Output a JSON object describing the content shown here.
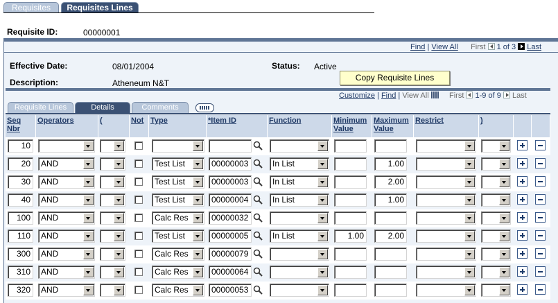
{
  "page_tabs": [
    {
      "label": "Requisites",
      "active": false
    },
    {
      "label": "Requisites Lines",
      "active": true
    }
  ],
  "requisite": {
    "id_label": "Requisite ID:",
    "id_value": "00000001"
  },
  "outer_nav": {
    "find": "Find",
    "view_all": "View All",
    "first": "First",
    "range": "1 of 3",
    "last": "Last"
  },
  "effdt": {
    "label": "Effective Date:",
    "value": "08/01/2004"
  },
  "status": {
    "label": "Status:",
    "value": "Active"
  },
  "description": {
    "label": "Description:",
    "value": "Atheneum N&T"
  },
  "copy_button": "Copy Requisite Lines",
  "grid_nav": {
    "customize": "Customize",
    "find": "Find",
    "view_all": "View All",
    "first": "First",
    "range": "1-9 of 9",
    "last": "Last"
  },
  "grid_tabs": [
    {
      "label": "Requisite Lines",
      "active": false
    },
    {
      "label": "Details",
      "active": true
    },
    {
      "label": "Comments",
      "active": false
    }
  ],
  "columns": {
    "seq": "Seq Nbr",
    "operators": "Operators",
    "lparen": "(",
    "not": "Not",
    "type": "Type",
    "item_id": "*Item ID",
    "function": "Function",
    "min": "Minimum Value",
    "max": "Maximum Value",
    "restrict": "Restrict",
    "rparen": ")"
  },
  "rows": [
    {
      "seq": "10",
      "operator": "",
      "type": "",
      "item": "",
      "function": "",
      "min": "",
      "max": ""
    },
    {
      "seq": "20",
      "operator": "AND",
      "type": "Test List",
      "item": "00000003",
      "function": "In List",
      "min": "",
      "max": "1.00"
    },
    {
      "seq": "30",
      "operator": "AND",
      "type": "Test List",
      "item": "00000003",
      "function": "In List",
      "min": "",
      "max": "2.00"
    },
    {
      "seq": "40",
      "operator": "AND",
      "type": "Test List",
      "item": "00000004",
      "function": "In List",
      "min": "",
      "max": "1.00"
    },
    {
      "seq": "100",
      "operator": "AND",
      "type": "Calc Res",
      "item": "00000032",
      "function": "",
      "min": "",
      "max": ""
    },
    {
      "seq": "110",
      "operator": "AND",
      "type": "Test List",
      "item": "00000005",
      "function": "In List",
      "min": "1.00",
      "max": "2.00"
    },
    {
      "seq": "300",
      "operator": "AND",
      "type": "Calc Res",
      "item": "00000079",
      "function": "",
      "min": "",
      "max": ""
    },
    {
      "seq": "310",
      "operator": "AND",
      "type": "Calc Res",
      "item": "00000064",
      "function": "",
      "min": "",
      "max": ""
    },
    {
      "seq": "320",
      "operator": "AND",
      "type": "Calc Res",
      "item": "00000053",
      "function": "",
      "min": "",
      "max": ""
    }
  ]
}
